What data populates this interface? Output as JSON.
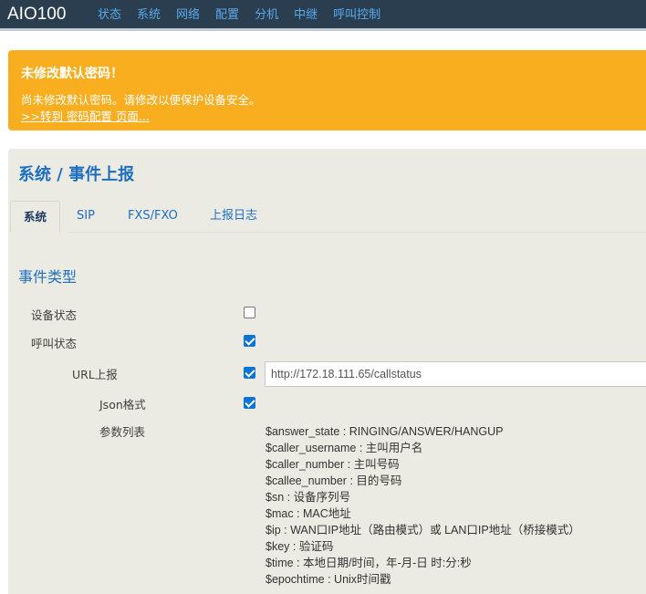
{
  "app": {
    "brand": "AIO100"
  },
  "nav": [
    "状态",
    "系统",
    "网络",
    "配置",
    "分机",
    "中继",
    "呼叫控制"
  ],
  "alert": {
    "title": "未修改默认密码！",
    "message": "尚未修改默认密码。请修改以便保护设备安全。",
    "link": ">>转到 密码配置 页面..."
  },
  "page": {
    "title": "系统 / 事件上报"
  },
  "tabs": [
    "系统",
    "SIP",
    "FXS/FXO",
    "上报日志"
  ],
  "section": {
    "title": "事件类型"
  },
  "form": {
    "device_status": {
      "label": "设备状态",
      "checked": false
    },
    "call_status": {
      "label": "呼叫状态",
      "checked": true
    },
    "url_report": {
      "label": "URL上报",
      "checked": true,
      "value": "http://172.18.111.65/callstatus"
    },
    "json_format": {
      "label": "Json格式",
      "checked": true
    },
    "param_list_label": "参数列表"
  },
  "params": [
    "$answer_state : RINGING/ANSWER/HANGUP",
    "$caller_username : 主叫用户名",
    "$caller_number : 主叫号码",
    "$callee_number : 目的号码",
    "$sn : 设备序列号",
    "$mac : MAC地址",
    "$ip : WAN口IP地址（路由模式）或 LAN口IP地址（桥接模式）",
    "$key : 验证码",
    "$time : 本地日期/时间，年-月-日 时:分:秒",
    "$epochtime : Unix时间戳"
  ],
  "colors": {
    "topbar": "#2b3e50",
    "nav_link": "#58a9ea",
    "alert": "#f8ae1f",
    "accent": "#1f6fbf",
    "checkbox": "#0b75d4",
    "panel": "#ebebe3"
  }
}
